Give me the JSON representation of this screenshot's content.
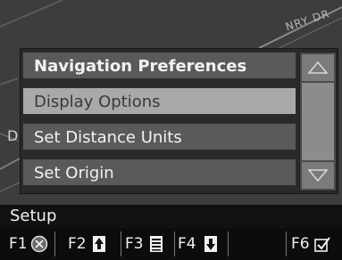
{
  "map": {
    "road_label": "NRY DR",
    "edge_label": "D"
  },
  "menu": {
    "items": [
      {
        "label": "Navigation Preferences",
        "state": "normal"
      },
      {
        "label": "Display Options",
        "state": "highlighted"
      },
      {
        "label": "Set Distance Units",
        "state": "normal"
      },
      {
        "label": "Set Origin",
        "state": "normal"
      }
    ],
    "scroll_up_icon": "triangle-up-icon",
    "scroll_down_icon": "triangle-down-icon"
  },
  "screen_title": "Setup",
  "function_keys": [
    {
      "key": "F1",
      "icon": "cancel-circle-x-icon"
    },
    {
      "key": "F2",
      "icon": "page-up-arrow-icon"
    },
    {
      "key": "F3",
      "icon": "list-menu-icon"
    },
    {
      "key": "F4",
      "icon": "page-down-arrow-icon"
    },
    {
      "key": "F6",
      "icon": "checkbox-check-icon"
    }
  ],
  "colors": {
    "map_background": "#3d3d3d",
    "menu_item": "#5a5a5a",
    "menu_item_highlight": "#a9a9a9",
    "bar_background": "#111111",
    "text": "#f2f2f2"
  }
}
